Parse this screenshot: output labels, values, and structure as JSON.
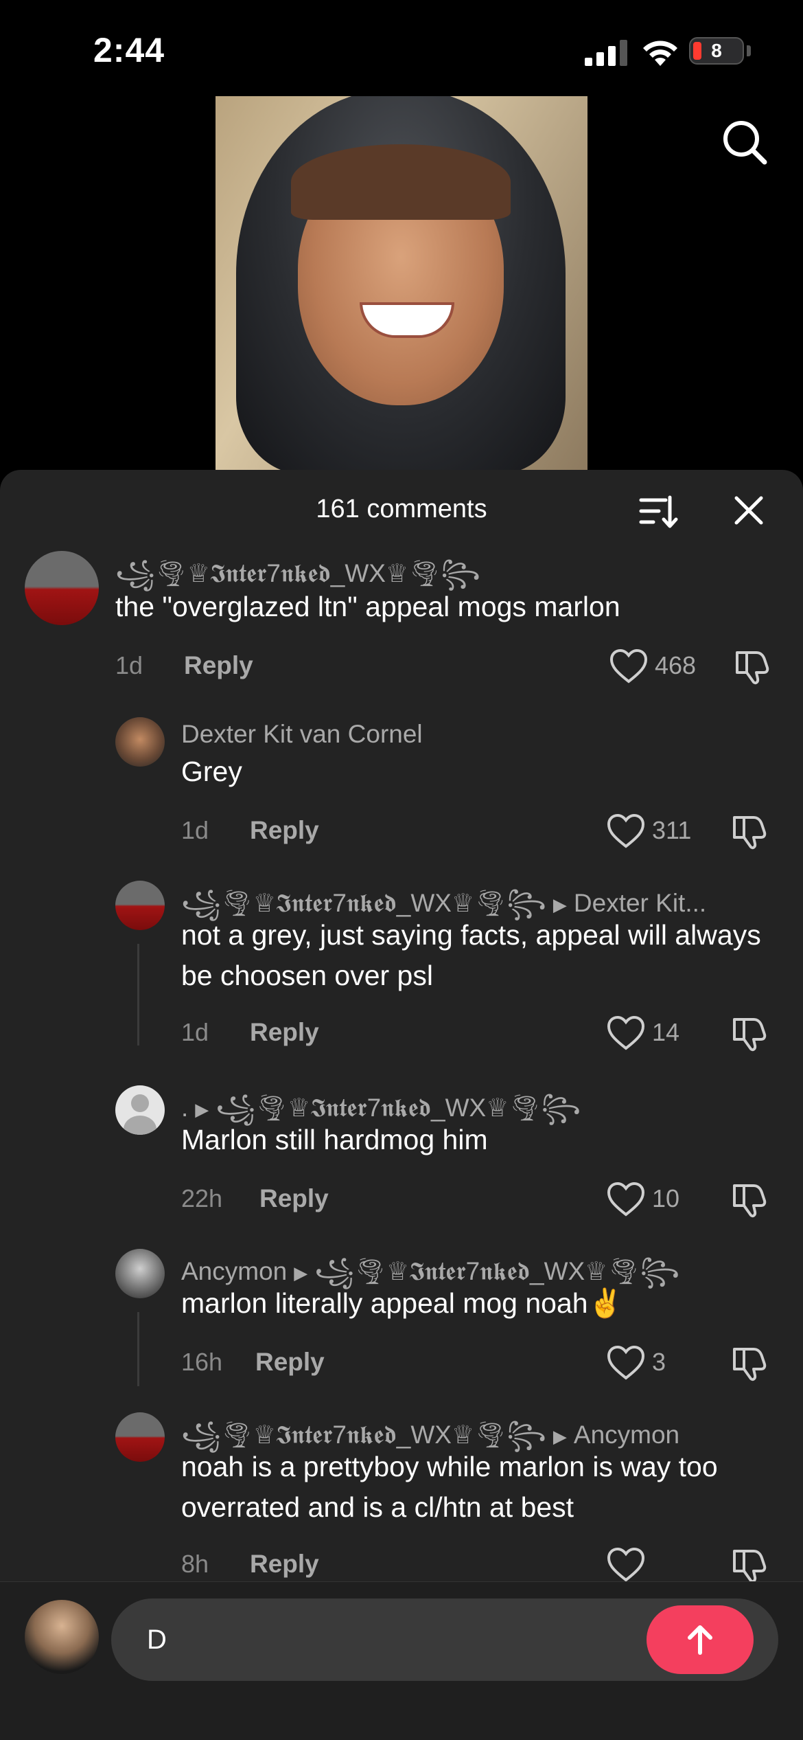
{
  "status_bar": {
    "time": "2:44",
    "battery": "8"
  },
  "sheet": {
    "comment_count": "161 comments"
  },
  "comments": [
    {
      "username": "꧁🌪♕𝕴𝖓𝖙𝖊𝖗7𝖓𝖐𝖊𝖉_WX♕🌪꧂",
      "text": "the \"overglazed ltn\" appeal mogs marlon",
      "time": "1d",
      "reply": "Reply",
      "likes": "468"
    },
    {
      "username": "Dexter Kit van Cornel",
      "text": "Grey",
      "time": "1d",
      "reply": "Reply",
      "likes": "311"
    },
    {
      "username": "꧁🌪♕𝕴𝖓𝖙𝖊𝖗7𝖓𝖐𝖊𝖉_WX♕🌪꧂",
      "reply_to": "Dexter Kit...",
      "text": "not a grey, just saying facts, appeal will always be choosen over psl",
      "time": "1d",
      "reply": "Reply",
      "likes": "14"
    },
    {
      "username": ".",
      "reply_to": "꧁🌪♕𝕴𝖓𝖙𝖊𝖗7𝖓𝖐𝖊𝖉_WX♕🌪꧂",
      "text": "Marlon still hardmog him",
      "time": "22h",
      "reply": "Reply",
      "likes": "10"
    },
    {
      "username": "Ancymon",
      "reply_to": "꧁🌪♕𝕴𝖓𝖙𝖊𝖗7𝖓𝖐𝖊𝖉_WX♕🌪꧂",
      "text": "marlon literally appeal mog noah✌️",
      "time": "16h",
      "reply": "Reply",
      "likes": "3"
    },
    {
      "username": "꧁🌪♕𝕴𝖓𝖙𝖊𝖗7𝖓𝖐𝖊𝖉_WX♕🌪꧂",
      "reply_to": "Ancymon",
      "text": "noah is a prettyboy while marlon is way too overrated and is a cl/htn at best",
      "time": "8h",
      "reply": "Reply",
      "likes": ""
    }
  ],
  "composer": {
    "value": "D"
  },
  "colors": {
    "accent": "#f43f5e",
    "sheet_bg": "#232323",
    "secondary_text": "#a9a9a9"
  }
}
